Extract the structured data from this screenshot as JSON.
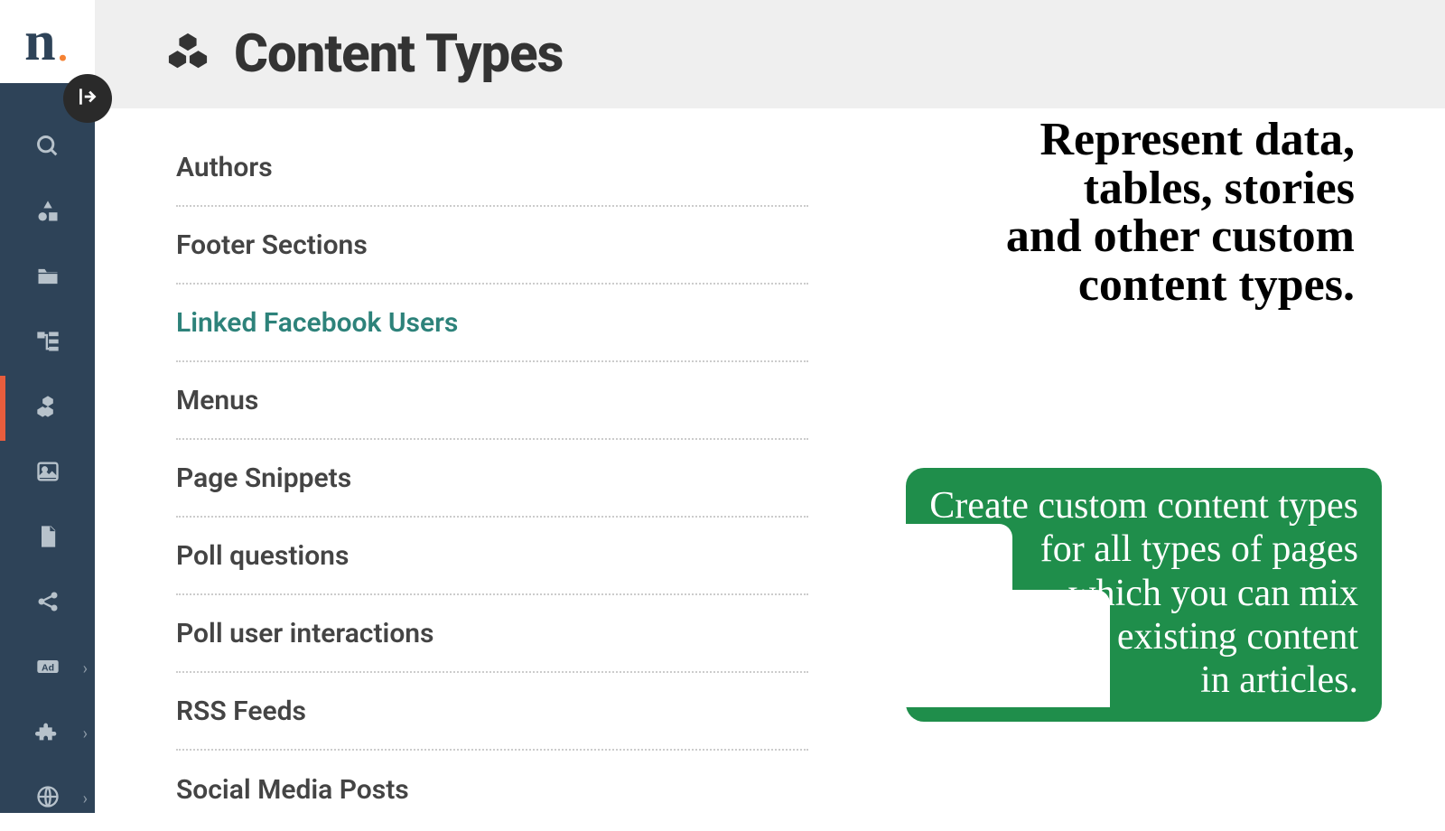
{
  "logo": {
    "letter": "n",
    "dot": "."
  },
  "header": {
    "title": "Content Types"
  },
  "content_types": [
    {
      "label": "Authors",
      "highlight": false
    },
    {
      "label": "Footer Sections",
      "highlight": false
    },
    {
      "label": "Linked Facebook Users",
      "highlight": true
    },
    {
      "label": "Menus",
      "highlight": false
    },
    {
      "label": "Page Snippets",
      "highlight": false
    },
    {
      "label": "Poll questions",
      "highlight": false
    },
    {
      "label": "Poll user interactions",
      "highlight": false
    },
    {
      "label": "RSS Feeds",
      "highlight": false
    },
    {
      "label": "Social Media Posts",
      "highlight": false
    }
  ],
  "slogan": {
    "line1": "Represent  data,",
    "line2": "tables, stories",
    "line3": "and other custom",
    "line4": "content types."
  },
  "callout": {
    "line1": "Create custom content types",
    "line2": "for all types of pages",
    "line3": "which you can mix",
    "line4": "with existing content",
    "line5": "in articles."
  },
  "nav": {
    "search": "search-icon",
    "shapes": "shapes-icon",
    "folder": "folder-icon",
    "tree": "tree-icon",
    "boxes": "boxes-icon",
    "image": "image-icon",
    "document": "document-icon",
    "share": "share-icon",
    "ad": "ad-icon",
    "puzzle": "puzzle-icon",
    "globe": "globe-icon"
  }
}
